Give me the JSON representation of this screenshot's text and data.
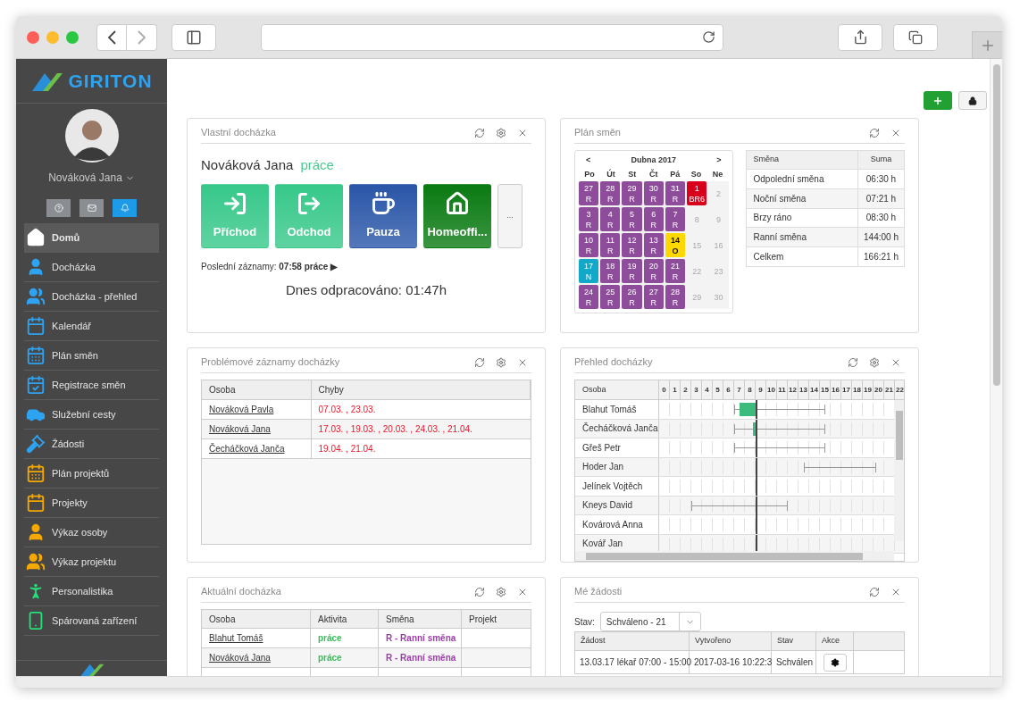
{
  "logo": {
    "text": "GIRITON"
  },
  "user": {
    "name": "Nováková Jana"
  },
  "quick_buttons": [
    {
      "kind": "help",
      "color": "#8a8d91"
    },
    {
      "kind": "mail",
      "color": "#8a8d91"
    },
    {
      "kind": "bell",
      "color": "#1e9be8"
    }
  ],
  "sidebar": {
    "items": [
      {
        "label": "Domů",
        "kind": "home",
        "color": "#ffffff",
        "selected": true
      },
      {
        "label": "Docházka",
        "kind": "person",
        "color": "#2ea3f2",
        "selected": false
      },
      {
        "label": "Docházka - přehled",
        "kind": "people",
        "color": "#2ea3f2",
        "selected": false
      },
      {
        "label": "Kalendář",
        "kind": "calendar",
        "color": "#2ea3f2",
        "selected": false
      },
      {
        "label": "Plán směn",
        "kind": "grid",
        "color": "#2ea3f2",
        "selected": false
      },
      {
        "label": "Registrace směn",
        "kind": "check",
        "color": "#2ea3f2",
        "selected": false
      },
      {
        "label": "Služební cesty",
        "kind": "car",
        "color": "#2ea3f2",
        "selected": false
      },
      {
        "label": "Žádosti",
        "kind": "gavel",
        "color": "#2ea3f2",
        "selected": false
      },
      {
        "label": "Plán projektů",
        "kind": "grid",
        "color": "#f5a800",
        "selected": false
      },
      {
        "label": "Projekty",
        "kind": "calendar",
        "color": "#f5a800",
        "selected": false
      },
      {
        "label": "Výkaz osoby",
        "kind": "person",
        "color": "#f5a800",
        "selected": false
      },
      {
        "label": "Výkaz projektu",
        "kind": "people",
        "color": "#f5a800",
        "selected": false
      },
      {
        "label": "Personalistika",
        "kind": "figure",
        "color": "#22e07a",
        "selected": false
      },
      {
        "label": "Spárovaná zařízení",
        "kind": "phone",
        "color": "#22e07a",
        "selected": false
      }
    ]
  },
  "own_attendance": {
    "title": "Vlastní docházka",
    "settings": true,
    "name": "Nováková Jana",
    "status": "práce",
    "buttons": [
      {
        "label": "Příchod",
        "kind": "arrive",
        "color": "#37c88a"
      },
      {
        "label": "Odchod",
        "kind": "leave",
        "color": "#37c88a"
      },
      {
        "label": "Pauza",
        "kind": "pause",
        "color": "#2a56a8"
      },
      {
        "label": "Homeoffi...",
        "kind": "home",
        "color": "#0a7a12"
      },
      {
        "label": "...",
        "kind": "more",
        "color": "#f4f4f4"
      }
    ],
    "last_label": "Poslední záznamy:",
    "last_value": "07:58 práce ▶",
    "worked_today": "Dnes odpracováno: 01:47h"
  },
  "shift_plan": {
    "title": "Plán směn",
    "settings": false,
    "month": "Dubna 2017",
    "prev": "<",
    "next": ">",
    "weekdays": [
      "Po",
      "Út",
      "St",
      "Čt",
      "Pá",
      "So",
      "Ne"
    ],
    "weeks": [
      [
        {
          "day": "27",
          "code": "R",
          "color": "#8e4d9b"
        },
        {
          "day": "28",
          "code": "R",
          "color": "#8e4d9b"
        },
        {
          "day": "29",
          "code": "R",
          "color": "#8e4d9b"
        },
        {
          "day": "30",
          "code": "R",
          "color": "#8e4d9b"
        },
        {
          "day": "31",
          "code": "R",
          "color": "#8e4d9b"
        },
        {
          "day": "1",
          "code": "BR6",
          "color": "#d9001b"
        },
        {
          "day": "2"
        }
      ],
      [
        {
          "day": "3",
          "code": "R",
          "color": "#8e4d9b"
        },
        {
          "day": "4",
          "code": "R",
          "color": "#8e4d9b"
        },
        {
          "day": "5",
          "code": "R",
          "color": "#8e4d9b"
        },
        {
          "day": "6",
          "code": "R",
          "color": "#8e4d9b"
        },
        {
          "day": "7",
          "code": "R",
          "color": "#8e4d9b"
        },
        {
          "day": "8"
        },
        {
          "day": "9"
        }
      ],
      [
        {
          "day": "10",
          "code": "R",
          "color": "#8e4d9b"
        },
        {
          "day": "11",
          "code": "R",
          "color": "#8e4d9b"
        },
        {
          "day": "12",
          "code": "R",
          "color": "#8e4d9b"
        },
        {
          "day": "13",
          "code": "R",
          "color": "#8e4d9b"
        },
        {
          "day": "14",
          "code": "O",
          "color": "#ffd800"
        },
        {
          "day": "15"
        },
        {
          "day": "16"
        }
      ],
      [
        {
          "day": "17",
          "code": "N",
          "color": "#12a8c8"
        },
        {
          "day": "18",
          "code": "R",
          "color": "#8e4d9b"
        },
        {
          "day": "19",
          "code": "R",
          "color": "#8e4d9b"
        },
        {
          "day": "20",
          "code": "R",
          "color": "#8e4d9b"
        },
        {
          "day": "21",
          "code": "R",
          "color": "#8e4d9b"
        },
        {
          "day": "22"
        },
        {
          "day": "23"
        }
      ],
      [
        {
          "day": "24",
          "code": "R",
          "color": "#8e4d9b"
        },
        {
          "day": "25",
          "code": "R",
          "color": "#8e4d9b"
        },
        {
          "day": "26",
          "code": "R",
          "color": "#8e4d9b"
        },
        {
          "day": "27",
          "code": "R",
          "color": "#8e4d9b"
        },
        {
          "day": "28",
          "code": "R",
          "color": "#8e4d9b"
        },
        {
          "day": "29"
        },
        {
          "day": "30"
        }
      ]
    ],
    "summary": {
      "columns": [
        "Směna",
        "Suma"
      ],
      "rows": [
        [
          "Odpolední směna",
          "06:30 h"
        ],
        [
          "Noční směna",
          "07:21 h"
        ],
        [
          "Brzy ráno",
          "08:30 h"
        ],
        [
          "Ranní směna",
          "144:00 h"
        ],
        [
          "Celkem",
          "166:21 h"
        ]
      ]
    }
  },
  "problem_records": {
    "title": "Problémové záznamy docházky",
    "settings": true,
    "columns": [
      "Osoba",
      "Chyby"
    ],
    "separator": ",",
    "rows": [
      {
        "person": "Nováková Pavla",
        "errors": [
          "07.03.",
          "23.03."
        ]
      },
      {
        "person": "Nováková Jana",
        "errors": [
          "17.03.",
          "19.03.",
          "20.03.",
          "24.03.",
          "21.04."
        ]
      },
      {
        "person": "Čecháčková Janča",
        "errors": [
          "19.04.",
          "21.04."
        ]
      }
    ]
  },
  "attendance_overview": {
    "title": "Přehled docházky",
    "settings": true,
    "name_column": "Osoba",
    "hours": [
      "0",
      "1",
      "2",
      "3",
      "4",
      "5",
      "6",
      "7",
      "8",
      "9",
      "10",
      "11",
      "12",
      "13",
      "14",
      "15",
      "16",
      "17",
      "18",
      "19",
      "20",
      "21",
      "22"
    ],
    "rows": [
      {
        "person": "Blahut Tomáš"
      },
      {
        "person": "Čecháčková Janča"
      },
      {
        "person": "Gřeš Petr"
      },
      {
        "person": "Hoder Jan"
      },
      {
        "person": "Jelínek Vojtěch"
      },
      {
        "person": "Kneys David"
      },
      {
        "person": "Kovárová Anna"
      },
      {
        "person": "Kovář Jan"
      }
    ]
  },
  "current_attendance": {
    "title": "Aktuální docházka",
    "settings": true,
    "columns": [
      "Osoba",
      "Aktivita",
      "Směna",
      "Projekt"
    ],
    "rows": [
      [
        "Blahut Tomáš",
        "práce",
        "R - Ranní směna",
        ""
      ],
      [
        "Nováková Jana",
        "práce",
        "R - Ranní směna",
        ""
      ]
    ]
  },
  "my_requests": {
    "title": "Mé žádosti",
    "settings": false,
    "filter_label": "Stav:",
    "filter_value": "Schváleno - 21",
    "columns": [
      "Žádost",
      "Vytvořeno",
      "Stav",
      "Akce"
    ],
    "rows": [
      [
        "13.03.17 lékař 07:00 - 15:00",
        "2017-03-16 10:22:3",
        "Schválen"
      ]
    ]
  }
}
